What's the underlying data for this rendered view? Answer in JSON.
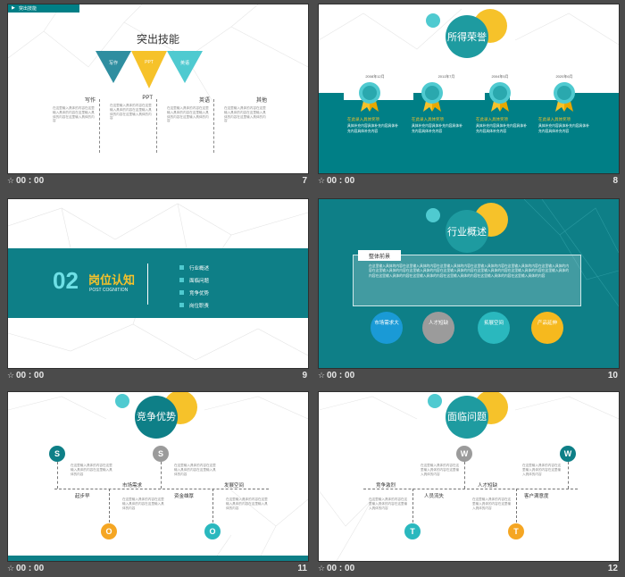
{
  "colors": {
    "teal": "#007f86",
    "teal_light": "#4fcad0",
    "yellow": "#f6c22a",
    "orange": "#f5a623",
    "grey": "#9b9b9b",
    "dark_bg": "#4b4b4b"
  },
  "meta_star": "☆",
  "meta_time": "00 : 00",
  "slides": {
    "s7": {
      "num": "7",
      "top_label": "突出技能",
      "title": "突出技能",
      "tri_labels": [
        "写作",
        "PPT",
        "英语"
      ],
      "columns": [
        {
          "title": "写作",
          "text": "在这里输入具体的内容在这里输入具体的内容在这里输入具体的内容在这里输入具体的内容"
        },
        {
          "title": "PPT",
          "text": "在这里输入具体的内容在这里输入具体的内容在这里输入具体的内容在这里输入具体的内容"
        },
        {
          "title": "英语",
          "text": "在这里输入具体的内容在这里输入具体的内容在这里输入具体的内容在这里输入具体的内容"
        },
        {
          "title": "其他",
          "text": "在这里输入具体的内容在这里输入具体的内容在这里输入具体的内容在这里输入具体的内容"
        }
      ]
    },
    "s8": {
      "num": "8",
      "title": "所得荣誉",
      "awards": [
        {
          "date": "2008年12月",
          "head": "在此录入具体奖项",
          "text": "具体补充内容具体补充内容具体补充内容具体补充内容"
        },
        {
          "date": "2011年7月",
          "head": "在此录入具体奖项",
          "text": "具体补充内容具体补充内容具体补充内容具体补充内容"
        },
        {
          "date": "2004年5月",
          "head": "在此录入具体奖项",
          "text": "具体补充内容具体补充内容具体补充内容具体补充内容"
        },
        {
          "date": "2020年6月",
          "head": "在此录入具体奖项",
          "text": "具体补充内容具体补充内容具体补充内容具体补充内容"
        }
      ]
    },
    "s9": {
      "num": "9",
      "section_no": "02",
      "section_title": "岗位认知",
      "section_sub": "POST COGNITION",
      "items": [
        "行业概述",
        "面临问题",
        "竞争优势",
        "岗位职责"
      ]
    },
    "s10": {
      "num": "10",
      "title": "行业概述",
      "box_title": "整体前景",
      "box_text": "在这里输入具体的内容在这里输入具体的内容在这里输入具体的内容在这里输入具体的内容在这里输入具体的内容在这里输入具体的内容在这里输入具体的内容在这里输入具体的内容在这里输入具体的内容在这里输入具体的内容在这里输入具体的内容在这里输入具体的内容在这里输入具体的内容在这里输入具体的内容在这里输入具体的内容在这里输入具体的内容在这里输入具体的内容",
      "bubbles": [
        "市场需求大",
        "人才短缺",
        "拓展空间",
        "产品延伸"
      ]
    },
    "s11": {
      "num": "11",
      "title": "竞争优势",
      "letters": [
        "S",
        "S",
        "O",
        "O"
      ],
      "labels": [
        "起步早",
        "市场需求",
        "资金雄厚",
        "发展空间"
      ],
      "text": "在这里输入具体的内容在这里输入具体的内容在这里输入具体的内容"
    },
    "s12": {
      "num": "12",
      "title": "面临问题",
      "letters": [
        "W",
        "W",
        "T",
        "T"
      ],
      "labels": [
        "竞争激烈",
        "人员流失",
        "人才短缺",
        "客户满意度"
      ],
      "text": "在这里输入具体的内容在这里输入具体的内容在这里输入具体的内容"
    }
  }
}
